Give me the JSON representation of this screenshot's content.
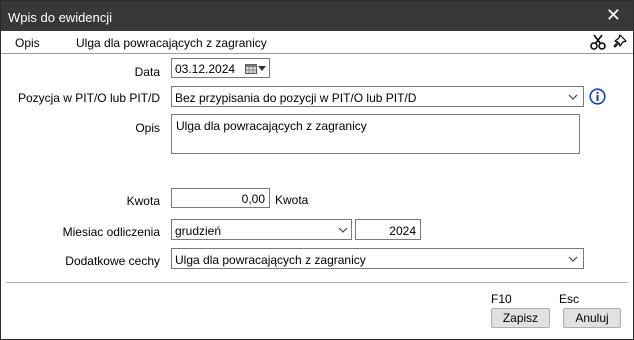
{
  "window": {
    "title": "Wpis do ewidencji"
  },
  "subheader": {
    "label": "Opis",
    "value": "Ulga dla powracających z zagranicy"
  },
  "form": {
    "data_label": "Data",
    "data_value": "03.12.2024",
    "pozycja_label": "Pozycja w  PIT/O lub PIT/D",
    "pozycja_value": "Bez przypisania do pozycji w PIT/O lub PIT/D",
    "opis_label": "Opis",
    "opis_value": "Ulga dla powracających z zagranicy",
    "kwota_label": "Kwota",
    "kwota_value": "0,00",
    "kwota_suffix": "Kwota",
    "miesiac_label": "Miesiac odliczenia",
    "miesiac_value": "grudzień",
    "rok_value": "2024",
    "cechy_label": "Dodatkowe cechy",
    "cechy_value": "Ulga dla powracających z zagranicy"
  },
  "footer": {
    "save_key": "F10",
    "save_label": "Zapisz",
    "cancel_key": "Esc",
    "cancel_label": "Anuluj"
  },
  "colors": {
    "titlebar": "#383838",
    "info_accent": "#1a3fb5"
  }
}
